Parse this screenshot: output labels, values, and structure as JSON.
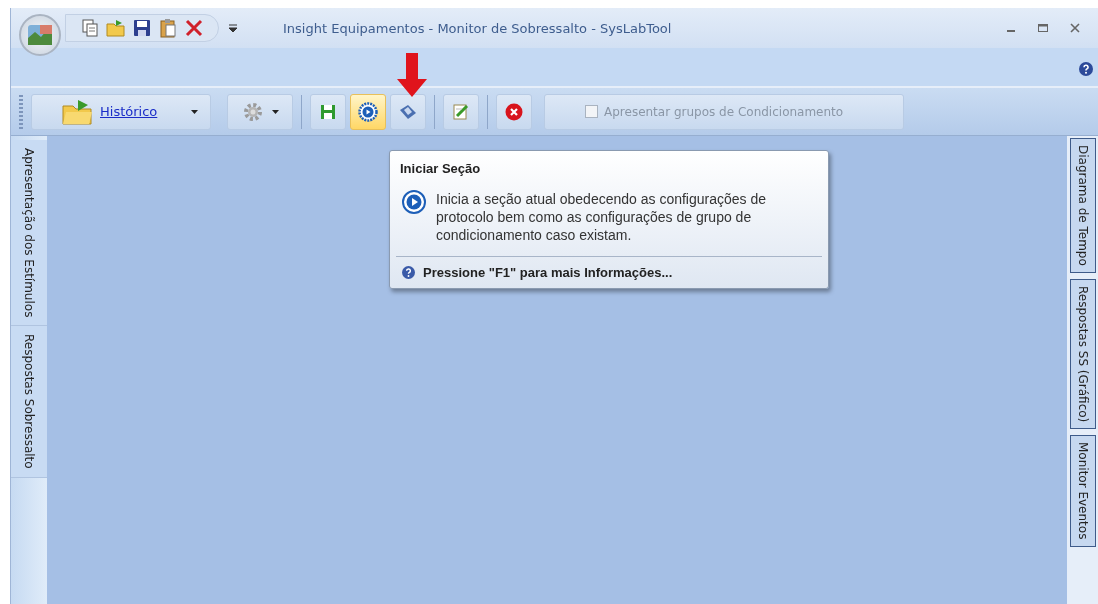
{
  "window": {
    "title": "Insight Equipamentos - Monitor de Sobressalto - SysLabTool"
  },
  "toolbar": [
    {
      "kind": "split",
      "label": "Histórico"
    },
    {
      "kind": "dropdown"
    },
    {
      "kind": "button",
      "hot": false
    },
    {
      "kind": "button",
      "hot": true
    },
    {
      "kind": "button",
      "hot": false
    },
    {
      "kind": "button",
      "hot": false
    },
    {
      "kind": "button",
      "hot": false
    },
    {
      "kind": "checkbox",
      "label": "Apresentar grupos de Condicionamento",
      "checked": false,
      "disabled": true
    }
  ],
  "left_tabs": [
    {
      "label": "Apresentação dos Estímulos"
    },
    {
      "label": "Respostas Sobressalto"
    }
  ],
  "right_tabs": [
    {
      "label": "Diagrama de Tempo"
    },
    {
      "label": "Respostas SS (Gráfico)"
    },
    {
      "label": "Monitor Eventos"
    }
  ],
  "tooltip": {
    "title": "Iniciar Seção",
    "body": "Inicia a seção atual obedecendo as configurações de protocolo bem como as configurações de grupo de condicionamento caso existam.",
    "footer": "Pressione \"F1\" para mais Informações..."
  }
}
